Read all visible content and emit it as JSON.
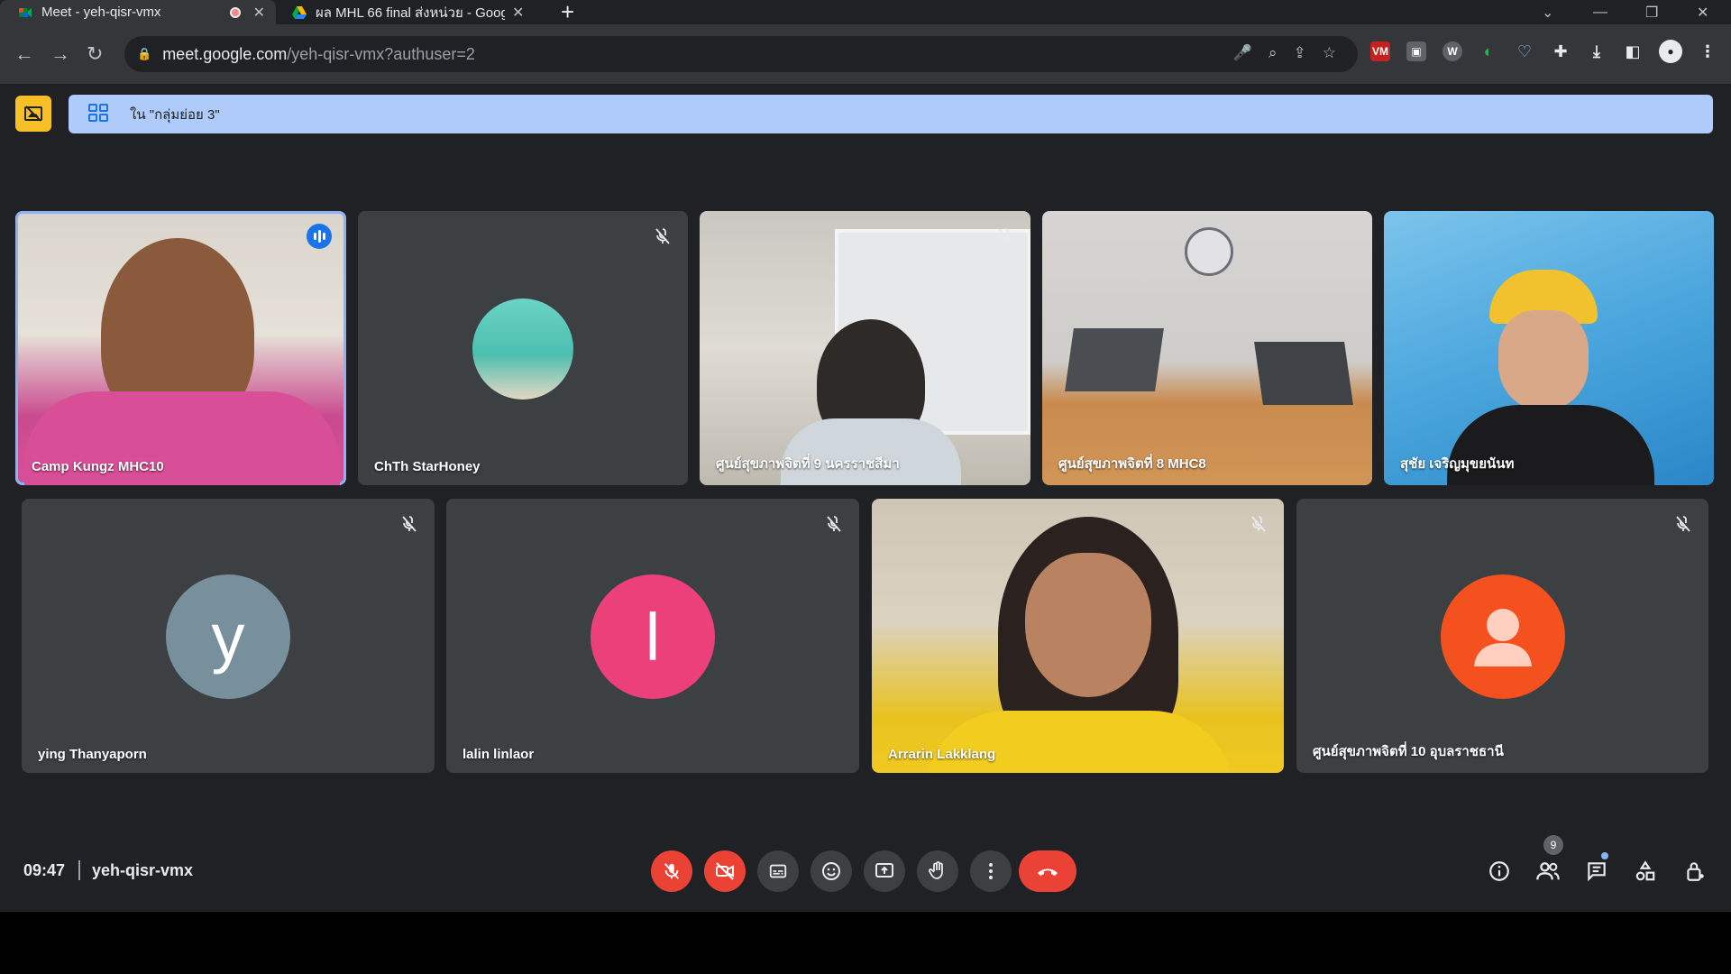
{
  "browser": {
    "tabs": [
      {
        "title": "Meet - yeh-qisr-vmx",
        "active": true,
        "icon": "meet-icon",
        "recording": true
      },
      {
        "title": "ผล MHL 66 final ส่งหน่วย - Googl",
        "active": false,
        "icon": "drive-icon"
      }
    ],
    "url_domain": "meet.google.com",
    "url_path": "/yeh-qisr-vmx?authuser=2"
  },
  "meet": {
    "banner_text": "ใน \"กลุ่มย่อย 3\"",
    "meeting_time": "09:47",
    "meeting_code": "yeh-qisr-vmx",
    "participant_count": "9",
    "colors": {
      "end_call": "#ea4335",
      "speaking_ring": "#8ab4f8",
      "banner": "#aecbfa"
    }
  },
  "participants": [
    {
      "name": "Camp Kungz MHC10",
      "video": true,
      "speaking": true,
      "muted": false
    },
    {
      "name": "ChTh StarHoney",
      "video": false,
      "muted": true,
      "avatar": "photo"
    },
    {
      "name": "ศูนย์สุขภาพจิตที่ 9 นครราชสีมา",
      "video": true,
      "muted": true
    },
    {
      "name": "ศูนย์สุขภาพจิตที่ 8 MHC8",
      "video": true,
      "muted": false
    },
    {
      "name": "สุชัย เจริญมุขยนันท",
      "video": true,
      "muted": false
    },
    {
      "name": "ying Thanyaporn",
      "video": false,
      "muted": true,
      "avatar_letter": "y",
      "avatar_color": "#78909c"
    },
    {
      "name": "lalin linlaor",
      "video": false,
      "muted": true,
      "avatar_letter": "l",
      "avatar_color": "#ec407a"
    },
    {
      "name": "Arrarin Lakklang",
      "video": true,
      "muted": true
    },
    {
      "name": "ศูนย์สุขภาพจิตที่ 10 อุบลราชธานี",
      "video": false,
      "muted": true,
      "avatar_color": "#f4511e",
      "avatar": "person-icon"
    }
  ]
}
